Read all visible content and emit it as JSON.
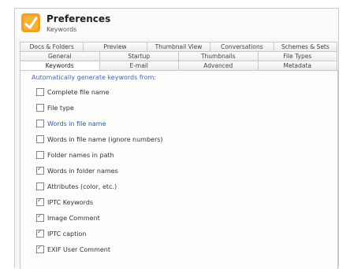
{
  "header": {
    "title": "Preferences",
    "subtitle": "Keywords"
  },
  "tabs": {
    "row1": [
      "Docs & Folders",
      "Preview",
      "Thumbnail View",
      "Conversations",
      "Schemes & Sets"
    ],
    "row2": [
      "General",
      "Startup",
      "Thumbnails",
      "File Types"
    ],
    "row3": [
      "Keywords",
      "E-mail",
      "Advanced",
      "Metadata"
    ]
  },
  "panel": {
    "group_label": "Automatically generate keywords from:",
    "items": [
      {
        "label": "Complete file name",
        "checked": false
      },
      {
        "label": "File type",
        "checked": false
      },
      {
        "label": "Words in file name",
        "checked": false
      },
      {
        "label": "Words in file name (ignore numbers)",
        "checked": false
      },
      {
        "label": "Folder names in path",
        "checked": false
      },
      {
        "label": "Words in folder names",
        "checked": true
      },
      {
        "label": "Attributes (color, etc.)",
        "checked": false
      },
      {
        "label": "IPTC Keywords",
        "checked": true
      },
      {
        "label": "Image Comment",
        "checked": true
      },
      {
        "label": "IPTC caption",
        "checked": true
      },
      {
        "label": "EXIF User Comment",
        "checked": true
      }
    ]
  }
}
